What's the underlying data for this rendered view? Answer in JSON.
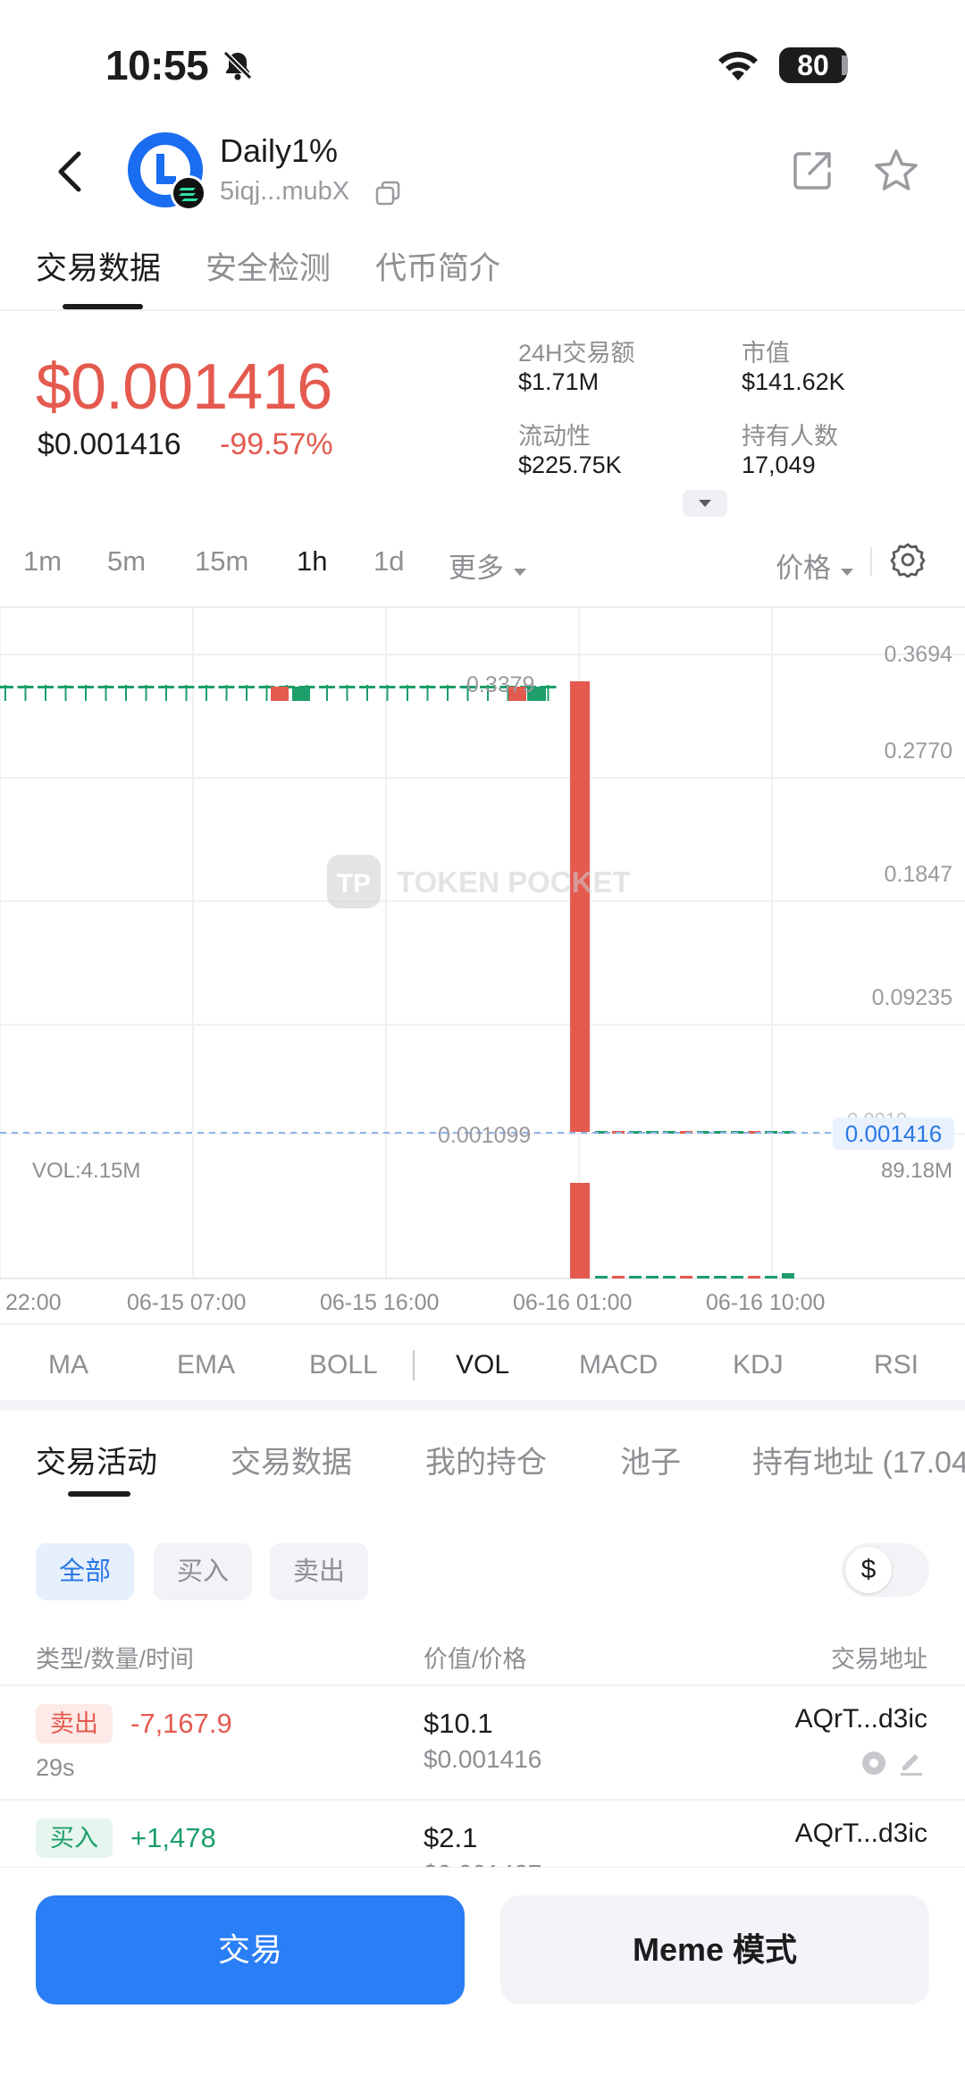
{
  "status_bar": {
    "time": "10:55",
    "battery": "80"
  },
  "header": {
    "token_name": "Daily1%",
    "token_address": "5iqj...mubX"
  },
  "top_tabs": [
    {
      "label": "交易数据",
      "active": true
    },
    {
      "label": "安全检测",
      "active": false
    },
    {
      "label": "代币简介",
      "active": false
    }
  ],
  "price": {
    "main": "$0.001416",
    "usd": "$0.001416",
    "change": "-99.57%"
  },
  "stats": [
    {
      "label": "24H交易额",
      "value": "$1.71M"
    },
    {
      "label": "市值",
      "value": "$141.62K"
    },
    {
      "label": "流动性",
      "value": "$225.75K"
    },
    {
      "label": "持有人数",
      "value": "17,049"
    }
  ],
  "timeframes": [
    {
      "label": "1m",
      "active": false
    },
    {
      "label": "5m",
      "active": false
    },
    {
      "label": "15m",
      "active": false
    },
    {
      "label": "1h",
      "active": true
    },
    {
      "label": "1d",
      "active": false
    },
    {
      "label": "更多",
      "active": false
    }
  ],
  "price_selector": "价格",
  "chart": {
    "y_ticks": [
      "0.3694",
      "0.2770",
      "0.1847",
      "0.09235"
    ],
    "high_label": "0.3379",
    "low_label": "0.001099",
    "current_price": "0.001416",
    "current_price_faint": "0.0010",
    "vol_label": "VOL:4.15M",
    "vol_max": "89.18M",
    "x_ticks": [
      "22:00",
      "06-15 07:00",
      "06-15 16:00",
      "06-16 01:00",
      "06-16 10:00"
    ],
    "watermark": "TOKEN POCKET",
    "colors": {
      "up": "#1d9e6a",
      "down": "#e55a4f",
      "current_line": "#8fb3ea"
    }
  },
  "chart_data": {
    "type": "candlestick",
    "timeframe": "1h",
    "ylim": [
      0.001099,
      0.3694
    ],
    "x_tick_labels": [
      "22:00",
      "06-15 07:00",
      "06-15 16:00",
      "06-16 01:00",
      "06-16 10:00"
    ],
    "summary": {
      "high": 0.3379,
      "low": 0.001099,
      "last": 0.001416
    },
    "volume_max": "89.18M",
    "current_volume": "VOL:4.15M"
  },
  "indicators": [
    {
      "label": "MA",
      "active": false
    },
    {
      "label": "EMA",
      "active": false
    },
    {
      "label": "BOLL",
      "active": false
    },
    {
      "label": "VOL",
      "active": true
    },
    {
      "label": "MACD",
      "active": false
    },
    {
      "label": "KDJ",
      "active": false
    },
    {
      "label": "RSI",
      "active": false
    }
  ],
  "bottom_tabs": [
    {
      "label": "交易活动",
      "active": true
    },
    {
      "label": "交易数据",
      "active": false
    },
    {
      "label": "我的持仓",
      "active": false
    },
    {
      "label": "池子",
      "active": false
    },
    {
      "label": "持有地址 (17.04",
      "active": false
    }
  ],
  "filters": [
    {
      "label": "全部",
      "active": true
    },
    {
      "label": "买入",
      "active": false
    },
    {
      "label": "卖出",
      "active": false
    }
  ],
  "currency_symbol": "$",
  "columns": {
    "type": "类型/数量/时间",
    "value": "价值/价格",
    "address": "交易地址"
  },
  "trades": [
    {
      "type": "卖出",
      "side": "sell",
      "amount": "-7,167.9",
      "time": "29s",
      "value": "$10.1",
      "price": "$0.001416",
      "address": "AQrT...d3ic"
    },
    {
      "type": "买入",
      "side": "buy",
      "amount": "+1,478",
      "time": "",
      "value": "$2.1",
      "price": "$0.001427",
      "address": "AQrT...d3ic"
    }
  ],
  "actions": {
    "trade": "交易",
    "meme": "Meme 模式"
  }
}
